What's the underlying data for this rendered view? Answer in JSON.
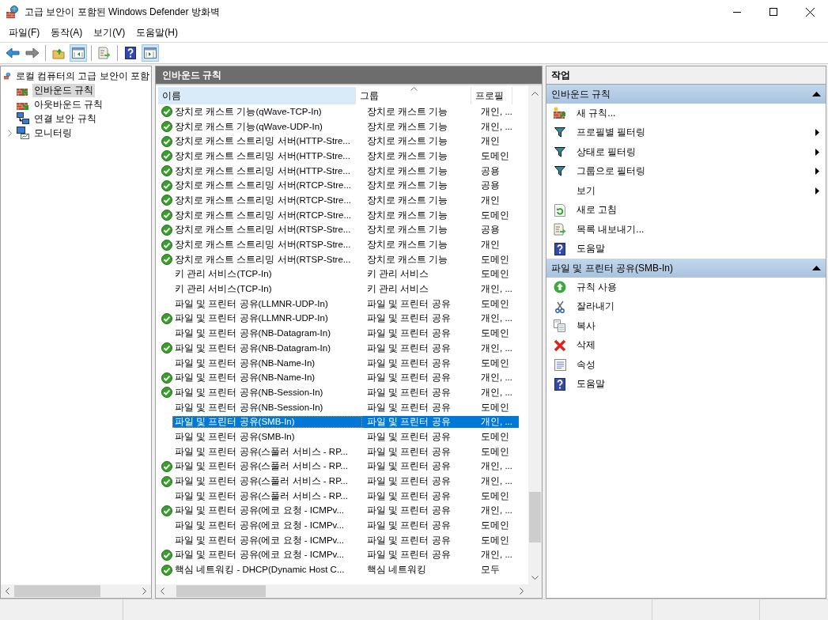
{
  "window": {
    "title": "고급 보안이 포함된 Windows Defender 방화벽"
  },
  "menu": [
    "파일(F)",
    "동작(A)",
    "보기(V)",
    "도움말(H)"
  ],
  "toolbar": [
    {
      "kind": "back",
      "pressed": false
    },
    {
      "kind": "forward",
      "pressed": false
    },
    {
      "kind": "sep"
    },
    {
      "kind": "up",
      "pressed": false
    },
    {
      "kind": "tree",
      "pressed": true
    },
    {
      "kind": "sep"
    },
    {
      "kind": "export",
      "pressed": false
    },
    {
      "kind": "sep"
    },
    {
      "kind": "help",
      "pressed": false
    },
    {
      "kind": "pane",
      "pressed": true
    }
  ],
  "tree": {
    "label": "로컬 컴퓨터의 고급 보안이 포함",
    "children": [
      {
        "label": "인바운드 규칙",
        "kind": "inbound",
        "selected": true,
        "expandable": false
      },
      {
        "label": "아웃바운드 규칙",
        "kind": "outbound",
        "selected": false,
        "expandable": false
      },
      {
        "label": "연결 보안 규칙",
        "kind": "connection",
        "selected": false,
        "expandable": false
      },
      {
        "label": "모니터링",
        "kind": "monitor",
        "selected": false,
        "expandable": true
      }
    ]
  },
  "table": {
    "title": "인바운드 규칙",
    "columns": [
      {
        "label": "이름",
        "highlighted": true,
        "sorted": false
      },
      {
        "label": "그룹",
        "highlighted": false,
        "sorted": true
      },
      {
        "label": "프로필",
        "highlighted": false,
        "sorted": false
      }
    ],
    "rows": [
      {
        "name": "장치로 캐스트 기능(qWave-TCP-In)",
        "group": "장치로 캐스트 기능",
        "profile": "개인, ...",
        "enabled": true,
        "selected": false
      },
      {
        "name": "장치로 캐스트 기능(qWave-UDP-In)",
        "group": "장치로 캐스트 기능",
        "profile": "개인, ...",
        "enabled": true,
        "selected": false
      },
      {
        "name": "장치로 캐스트 스트리밍 서버(HTTP-Stre...",
        "group": "장치로 캐스트 기능",
        "profile": "개인",
        "enabled": true,
        "selected": false
      },
      {
        "name": "장치로 캐스트 스트리밍 서버(HTTP-Stre...",
        "group": "장치로 캐스트 기능",
        "profile": "도메인",
        "enabled": true,
        "selected": false
      },
      {
        "name": "장치로 캐스트 스트리밍 서버(HTTP-Stre...",
        "group": "장치로 캐스트 기능",
        "profile": "공용",
        "enabled": true,
        "selected": false
      },
      {
        "name": "장치로 캐스트 스트리밍 서버(RTCP-Stre...",
        "group": "장치로 캐스트 기능",
        "profile": "공용",
        "enabled": true,
        "selected": false
      },
      {
        "name": "장치로 캐스트 스트리밍 서버(RTCP-Stre...",
        "group": "장치로 캐스트 기능",
        "profile": "개인",
        "enabled": true,
        "selected": false
      },
      {
        "name": "장치로 캐스트 스트리밍 서버(RTCP-Stre...",
        "group": "장치로 캐스트 기능",
        "profile": "도메인",
        "enabled": true,
        "selected": false
      },
      {
        "name": "장치로 캐스트 스트리밍 서버(RTSP-Stre...",
        "group": "장치로 캐스트 기능",
        "profile": "공용",
        "enabled": true,
        "selected": false
      },
      {
        "name": "장치로 캐스트 스트리밍 서버(RTSP-Stre...",
        "group": "장치로 캐스트 기능",
        "profile": "개인",
        "enabled": true,
        "selected": false
      },
      {
        "name": "장치로 캐스트 스트리밍 서버(RTSP-Stre...",
        "group": "장치로 캐스트 기능",
        "profile": "도메인",
        "enabled": true,
        "selected": false
      },
      {
        "name": "키 관리 서비스(TCP-In)",
        "group": "키 관리 서비스",
        "profile": "도메인",
        "enabled": false,
        "selected": false
      },
      {
        "name": "키 관리 서비스(TCP-In)",
        "group": "키 관리 서비스",
        "profile": "개인, ...",
        "enabled": false,
        "selected": false
      },
      {
        "name": "파일 및 프린터 공유(LLMNR-UDP-In)",
        "group": "파일 및 프린터 공유",
        "profile": "도메인",
        "enabled": false,
        "selected": false
      },
      {
        "name": "파일 및 프린터 공유(LLMNR-UDP-In)",
        "group": "파일 및 프린터 공유",
        "profile": "개인, ...",
        "enabled": true,
        "selected": false
      },
      {
        "name": "파일 및 프린터 공유(NB-Datagram-In)",
        "group": "파일 및 프린터 공유",
        "profile": "도메인",
        "enabled": false,
        "selected": false
      },
      {
        "name": "파일 및 프린터 공유(NB-Datagram-In)",
        "group": "파일 및 프린터 공유",
        "profile": "개인, ...",
        "enabled": true,
        "selected": false
      },
      {
        "name": "파일 및 프린터 공유(NB-Name-In)",
        "group": "파일 및 프린터 공유",
        "profile": "도메인",
        "enabled": false,
        "selected": false
      },
      {
        "name": "파일 및 프린터 공유(NB-Name-In)",
        "group": "파일 및 프린터 공유",
        "profile": "개인, ...",
        "enabled": true,
        "selected": false
      },
      {
        "name": "파일 및 프린터 공유(NB-Session-In)",
        "group": "파일 및 프린터 공유",
        "profile": "개인, ...",
        "enabled": true,
        "selected": false
      },
      {
        "name": "파일 및 프린터 공유(NB-Session-In)",
        "group": "파일 및 프린터 공유",
        "profile": "도메인",
        "enabled": false,
        "selected": false
      },
      {
        "name": "파일 및 프린터 공유(SMB-In)",
        "group": "파일 및 프린터 공유",
        "profile": "개인, ...",
        "enabled": false,
        "selected": true
      },
      {
        "name": "파일 및 프린터 공유(SMB-In)",
        "group": "파일 및 프린터 공유",
        "profile": "도메인",
        "enabled": false,
        "selected": false
      },
      {
        "name": "파일 및 프린터 공유(스풀러 서비스 - RP...",
        "group": "파일 및 프린터 공유",
        "profile": "도메인",
        "enabled": false,
        "selected": false
      },
      {
        "name": "파일 및 프린터 공유(스풀러 서비스 - RP...",
        "group": "파일 및 프린터 공유",
        "profile": "개인, ...",
        "enabled": true,
        "selected": false
      },
      {
        "name": "파일 및 프린터 공유(스풀러 서비스 - RP...",
        "group": "파일 및 프린터 공유",
        "profile": "개인, ...",
        "enabled": true,
        "selected": false
      },
      {
        "name": "파일 및 프린터 공유(스풀러 서비스 - RP...",
        "group": "파일 및 프린터 공유",
        "profile": "도메인",
        "enabled": false,
        "selected": false
      },
      {
        "name": "파일 및 프린터 공유(에코 요청 - ICMPv...",
        "group": "파일 및 프린터 공유",
        "profile": "개인, ...",
        "enabled": true,
        "selected": false
      },
      {
        "name": "파일 및 프린터 공유(에코 요청 - ICMPv...",
        "group": "파일 및 프린터 공유",
        "profile": "도메인",
        "enabled": false,
        "selected": false
      },
      {
        "name": "파일 및 프린터 공유(에코 요청 - ICMPv...",
        "group": "파일 및 프린터 공유",
        "profile": "도메인",
        "enabled": false,
        "selected": false
      },
      {
        "name": "파일 및 프린터 공유(에코 요청 - ICMPv...",
        "group": "파일 및 프린터 공유",
        "profile": "개인, ...",
        "enabled": true,
        "selected": false
      },
      {
        "name": "핵심 네트워킹 - DHCP(Dynamic Host C...",
        "group": "핵심 네트워킹",
        "profile": "모두",
        "enabled": true,
        "selected": false
      }
    ]
  },
  "actions": {
    "title": "작업",
    "sections": [
      {
        "title": "인바운드 규칙",
        "expanded": true,
        "items": [
          {
            "label": "새 규칙...",
            "kind": "new-rule",
            "submenu": false
          },
          {
            "label": "프로필별 필터링",
            "kind": "filter",
            "submenu": true
          },
          {
            "label": "상태로 필터링",
            "kind": "filter",
            "submenu": true
          },
          {
            "label": "그룹으로 필터링",
            "kind": "filter",
            "submenu": true
          },
          {
            "label": "보기",
            "kind": "none",
            "submenu": true
          },
          {
            "label": "새로 고침",
            "kind": "refresh",
            "submenu": false
          },
          {
            "label": "목록 내보내기...",
            "kind": "export",
            "submenu": false
          },
          {
            "label": "도움말",
            "kind": "help",
            "submenu": false
          }
        ]
      },
      {
        "title": "파일 및 프린터 공유(SMB-In)",
        "expanded": true,
        "items": [
          {
            "label": "규칙 사용",
            "kind": "enable",
            "submenu": false
          },
          {
            "label": "잘라내기",
            "kind": "cut",
            "submenu": false
          },
          {
            "label": "복사",
            "kind": "copy",
            "submenu": false
          },
          {
            "label": "삭제",
            "kind": "delete",
            "submenu": false
          },
          {
            "label": "속성",
            "kind": "properties",
            "submenu": false
          },
          {
            "label": "도움말",
            "kind": "help",
            "submenu": false
          }
        ]
      }
    ]
  }
}
